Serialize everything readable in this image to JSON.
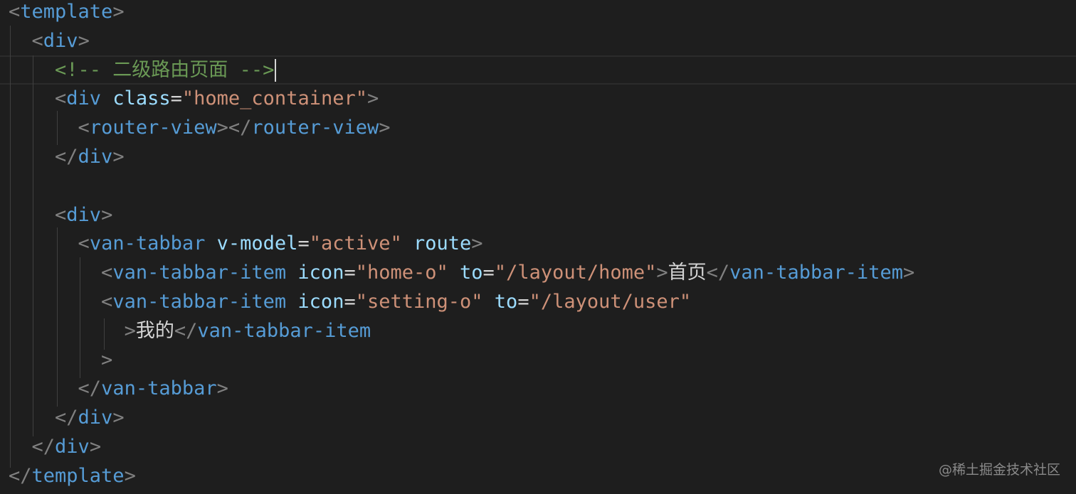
{
  "editor": {
    "lines": [
      [
        {
          "t": "<",
          "c": "punct"
        },
        {
          "t": "template",
          "c": "tag"
        },
        {
          "t": ">",
          "c": "punct"
        }
      ],
      [
        {
          "t": "  ",
          "c": "text"
        },
        {
          "t": "<",
          "c": "punct"
        },
        {
          "t": "div",
          "c": "tag"
        },
        {
          "t": ">",
          "c": "punct"
        }
      ],
      [
        {
          "t": "    ",
          "c": "text"
        },
        {
          "t": "<!-- 二级路由页面 -->",
          "c": "comment"
        }
      ],
      [
        {
          "t": "    ",
          "c": "text"
        },
        {
          "t": "<",
          "c": "punct"
        },
        {
          "t": "div",
          "c": "tag"
        },
        {
          "t": " ",
          "c": "text"
        },
        {
          "t": "class",
          "c": "attr"
        },
        {
          "t": "=",
          "c": "eq"
        },
        {
          "t": "\"home_container\"",
          "c": "str"
        },
        {
          "t": ">",
          "c": "punct"
        }
      ],
      [
        {
          "t": "      ",
          "c": "text"
        },
        {
          "t": "<",
          "c": "punct"
        },
        {
          "t": "router-view",
          "c": "tag"
        },
        {
          "t": "></",
          "c": "punct"
        },
        {
          "t": "router-view",
          "c": "tag"
        },
        {
          "t": ">",
          "c": "punct"
        }
      ],
      [
        {
          "t": "    ",
          "c": "text"
        },
        {
          "t": "</",
          "c": "punct"
        },
        {
          "t": "div",
          "c": "tag"
        },
        {
          "t": ">",
          "c": "punct"
        }
      ],
      [],
      [
        {
          "t": "    ",
          "c": "text"
        },
        {
          "t": "<",
          "c": "punct"
        },
        {
          "t": "div",
          "c": "tag"
        },
        {
          "t": ">",
          "c": "punct"
        }
      ],
      [
        {
          "t": "      ",
          "c": "text"
        },
        {
          "t": "<",
          "c": "punct"
        },
        {
          "t": "van-tabbar",
          "c": "tag"
        },
        {
          "t": " ",
          "c": "text"
        },
        {
          "t": "v-model",
          "c": "attr"
        },
        {
          "t": "=",
          "c": "eq"
        },
        {
          "t": "\"active\"",
          "c": "str"
        },
        {
          "t": " ",
          "c": "text"
        },
        {
          "t": "route",
          "c": "attr"
        },
        {
          "t": ">",
          "c": "punct"
        }
      ],
      [
        {
          "t": "        ",
          "c": "text"
        },
        {
          "t": "<",
          "c": "punct"
        },
        {
          "t": "van-tabbar-item",
          "c": "tag"
        },
        {
          "t": " ",
          "c": "text"
        },
        {
          "t": "icon",
          "c": "attr"
        },
        {
          "t": "=",
          "c": "eq"
        },
        {
          "t": "\"home-o\"",
          "c": "str"
        },
        {
          "t": " ",
          "c": "text"
        },
        {
          "t": "to",
          "c": "attr"
        },
        {
          "t": "=",
          "c": "eq"
        },
        {
          "t": "\"/layout/home\"",
          "c": "str"
        },
        {
          "t": ">",
          "c": "punct"
        },
        {
          "t": "首页",
          "c": "text"
        },
        {
          "t": "</",
          "c": "punct"
        },
        {
          "t": "van-tabbar-item",
          "c": "tag"
        },
        {
          "t": ">",
          "c": "punct"
        }
      ],
      [
        {
          "t": "        ",
          "c": "text"
        },
        {
          "t": "<",
          "c": "punct"
        },
        {
          "t": "van-tabbar-item",
          "c": "tag"
        },
        {
          "t": " ",
          "c": "text"
        },
        {
          "t": "icon",
          "c": "attr"
        },
        {
          "t": "=",
          "c": "eq"
        },
        {
          "t": "\"setting-o\"",
          "c": "str"
        },
        {
          "t": " ",
          "c": "text"
        },
        {
          "t": "to",
          "c": "attr"
        },
        {
          "t": "=",
          "c": "eq"
        },
        {
          "t": "\"/layout/user\"",
          "c": "str"
        }
      ],
      [
        {
          "t": "          ",
          "c": "text"
        },
        {
          "t": ">",
          "c": "punct"
        },
        {
          "t": "我的",
          "c": "text"
        },
        {
          "t": "</",
          "c": "punct"
        },
        {
          "t": "van-tabbar-item",
          "c": "tag"
        }
      ],
      [
        {
          "t": "        ",
          "c": "text"
        },
        {
          "t": ">",
          "c": "punct"
        }
      ],
      [
        {
          "t": "      ",
          "c": "text"
        },
        {
          "t": "</",
          "c": "punct"
        },
        {
          "t": "van-tabbar",
          "c": "tag"
        },
        {
          "t": ">",
          "c": "punct"
        }
      ],
      [
        {
          "t": "    ",
          "c": "text"
        },
        {
          "t": "</",
          "c": "punct"
        },
        {
          "t": "div",
          "c": "tag"
        },
        {
          "t": ">",
          "c": "punct"
        }
      ],
      [
        {
          "t": "  ",
          "c": "text"
        },
        {
          "t": "</",
          "c": "punct"
        },
        {
          "t": "div",
          "c": "tag"
        },
        {
          "t": ">",
          "c": "punct"
        }
      ],
      [
        {
          "t": "</",
          "c": "punct"
        },
        {
          "t": "template",
          "c": "tag"
        },
        {
          "t": ">",
          "c": "punct"
        }
      ]
    ],
    "cursor_line": 2
  },
  "watermark": "@稀土掘金技术社区",
  "colors": {
    "background": "#1e1e1e",
    "punctuation": "#808080",
    "tag": "#569cd6",
    "attribute": "#9cdcfe",
    "string": "#ce9178",
    "comment": "#6a9955",
    "text": "#d4d4d4"
  }
}
